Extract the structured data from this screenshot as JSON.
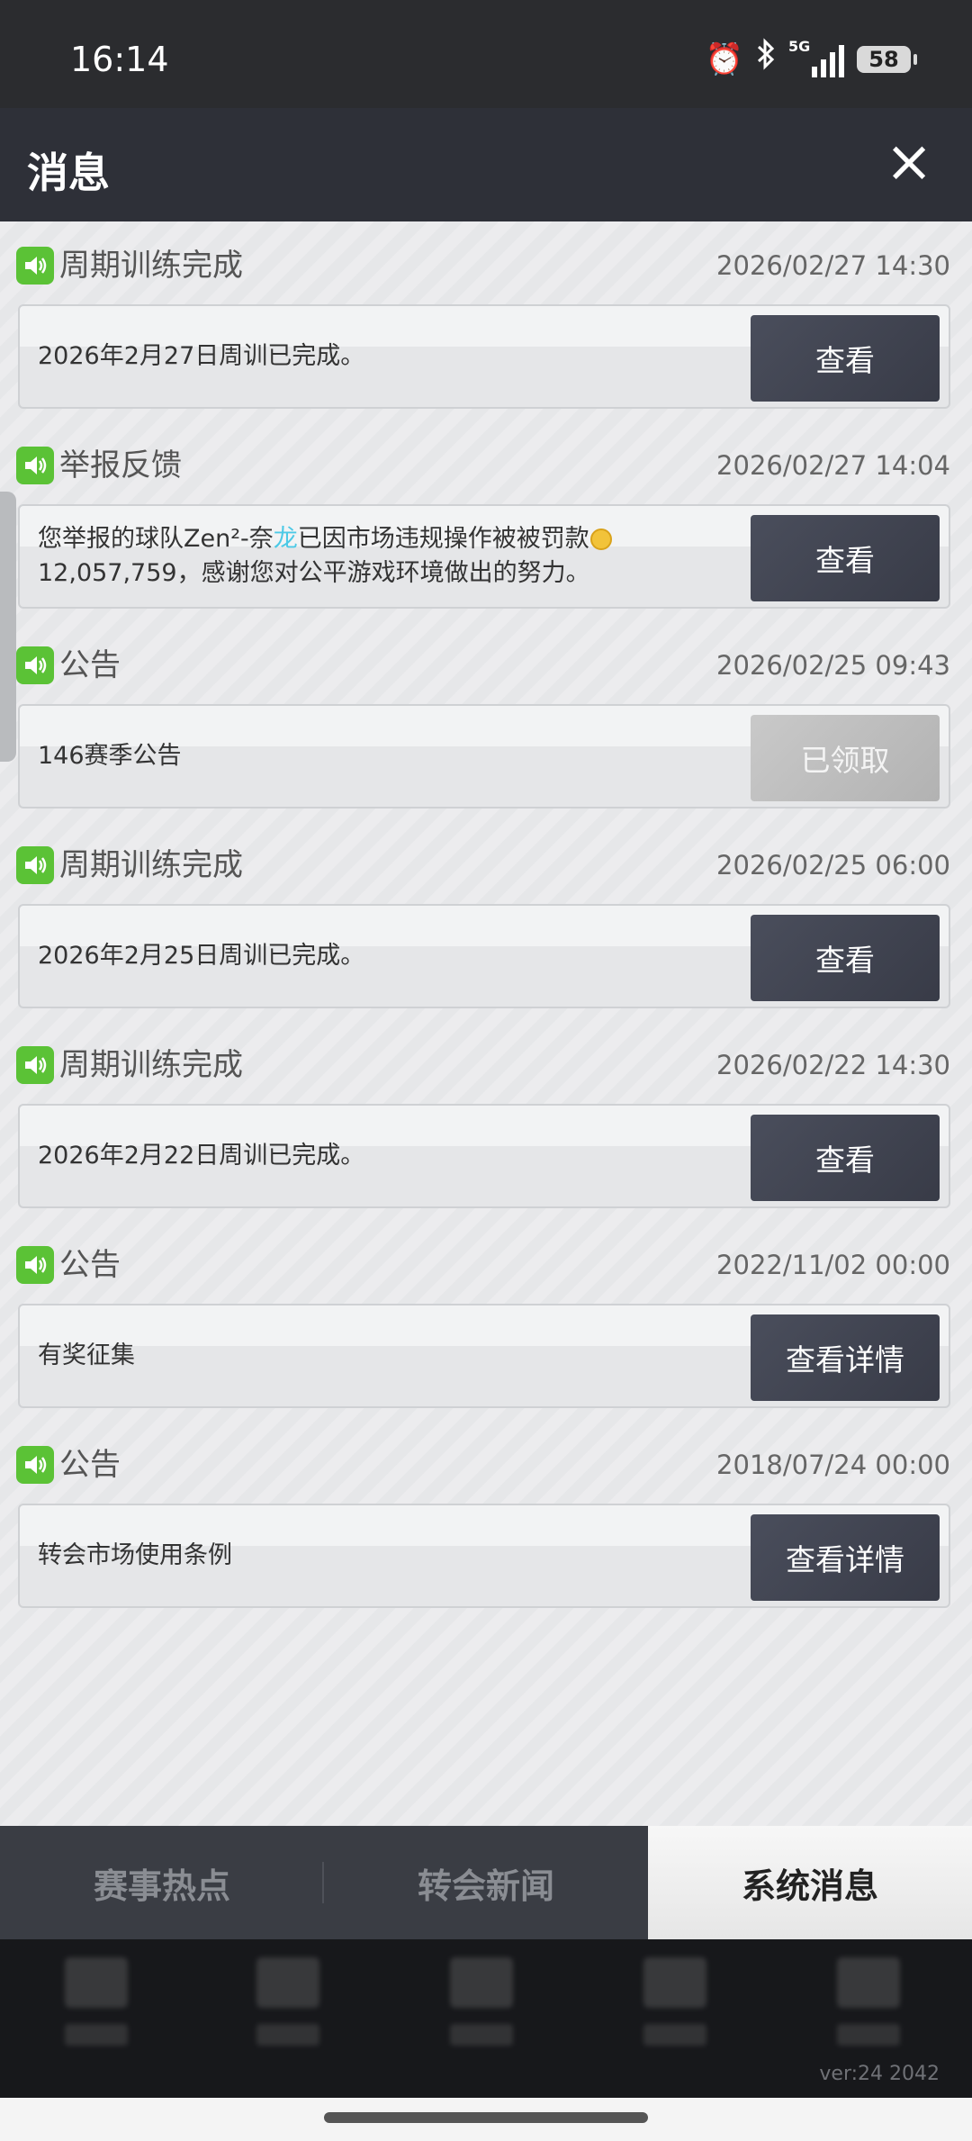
{
  "status_bar": {
    "time": "16:14",
    "battery": "58",
    "network": "5G"
  },
  "header": {
    "title": "消息",
    "close_icon": "×"
  },
  "messages": [
    {
      "category": "周期训练完成",
      "time": "2026/02/27 14:30",
      "text": "2026年2月27日周训已完成。",
      "button": "查看",
      "button_state": "active"
    },
    {
      "category": "举报反馈",
      "time": "2026/02/27 14:04",
      "text_part1": "您举报的球队Zen²-奈",
      "text_highlight": "龙",
      "text_part2": "已因市场违规操作被被罚款",
      "text_part3": "12,057,759，感谢您对公平游戏环境做出的努力。",
      "button": "查看",
      "button_state": "active"
    },
    {
      "category": "公告",
      "time": "2026/02/25 09:43",
      "text": "146赛季公告",
      "button": "已领取",
      "button_state": "disabled"
    },
    {
      "category": "周期训练完成",
      "time": "2026/02/25 06:00",
      "text": "2026年2月25日周训已完成。",
      "button": "查看",
      "button_state": "active"
    },
    {
      "category": "周期训练完成",
      "time": "2026/02/22 14:30",
      "text": "2026年2月22日周训已完成。",
      "button": "查看",
      "button_state": "active"
    },
    {
      "category": "公告",
      "time": "2022/11/02 00:00",
      "text": "有奖征集",
      "button": "查看详情",
      "button_state": "active"
    },
    {
      "category": "公告",
      "time": "2018/07/24 00:00",
      "text": "转会市场使用条例",
      "button": "查看详情",
      "button_state": "active"
    }
  ],
  "tabs": [
    {
      "label": "赛事热点",
      "active": false
    },
    {
      "label": "转会新闻",
      "active": false
    },
    {
      "label": "系统消息",
      "active": true
    }
  ],
  "footer": {
    "version": "ver:24  2042"
  },
  "colors": {
    "accent_green": "#5bc236",
    "header_bg": "#2e3038",
    "button_dark": "#434755",
    "highlight_cyan": "#4cc9e6"
  }
}
